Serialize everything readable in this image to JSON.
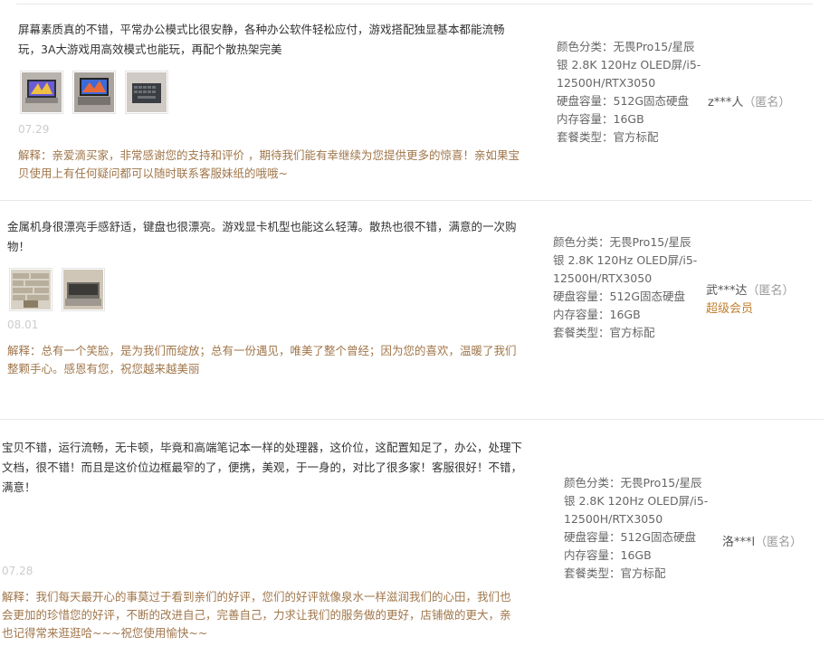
{
  "reviews": [
    {
      "content": "屏幕素质真的不错，平常办公模式比很安静，各种办公软件轻松应付，游戏搭配独显基本都能流畅玩，3A大游戏用高效模式也能玩，再配个散热架完美",
      "photos": [
        "photo-laptop-1",
        "photo-laptop-2",
        "photo-laptop-3"
      ],
      "date": "07.29",
      "reply_label": "解释：",
      "reply": "亲爱滴买家，非常感谢您的支持和评价 ，期待我们能有幸继续为您提供更多的惊喜！亲如果宝贝使用上有任何疑问都可以随时联系客服妹纸的哦哦~",
      "sku": [
        "颜色分类：无畏Pro15/星辰银 2.8K 120Hz OLED屏/i5-12500H/RTX3050",
        "硬盘容量：512G固态硬盘",
        "内存容量：16GB",
        "套餐类型：官方标配"
      ],
      "user": "z***人",
      "anon": "（匿名）",
      "vip": ""
    },
    {
      "content": "金属机身很漂亮手感舒适，键盘也很漂亮。游戏显卡机型也能这么轻薄。散热也很不错，满意的一次购物！",
      "photos": [
        "photo-box-1",
        "photo-box-2"
      ],
      "date": "08.01",
      "reply_label": "解释：",
      "reply": "总有一个笑脸，是为我们而绽放；总有一份遇见，唯美了整个曾经；因为您的喜欢，温暖了我们整颗手心。感恩有您，祝您越来越美丽",
      "sku": [
        "颜色分类：无畏Pro15/星辰银 2.8K 120Hz OLED屏/i5-12500H/RTX3050",
        "硬盘容量：512G固态硬盘",
        "内存容量：16GB",
        "套餐类型：官方标配"
      ],
      "user": "武***达",
      "anon": "（匿名）",
      "vip": "超级会员"
    },
    {
      "content": "宝贝不错，运行流畅，无卡顿，毕竟和高端笔记本一样的处理器，这价位，这配置知足了，办公，处理下文档，很不错！而且是这价位边框最窄的了，便携，美观，于一身的，对比了很多家！客服很好！不错，满意！",
      "photos": [],
      "date": "07.28",
      "reply_label": "解释：",
      "reply": "我们每天最开心的事莫过于看到亲们的好评，您们的好评就像泉水一样滋润我们的心田，我们也会更加的珍惜您的好评，不断的改进自己，完善自己，力求让我们的服务做的更好，店铺做的更大，亲也记得常来逛逛哈~~~祝您使用愉快~~",
      "sku": [
        "颜色分类：无畏Pro15/星辰银 2.8K 120Hz OLED屏/i5-12500H/RTX3050",
        "硬盘容量：512G固态硬盘",
        "内存容量：16GB",
        "套餐类型：官方标配"
      ],
      "user": "洛***l",
      "anon": "（匿名）",
      "vip": ""
    }
  ]
}
